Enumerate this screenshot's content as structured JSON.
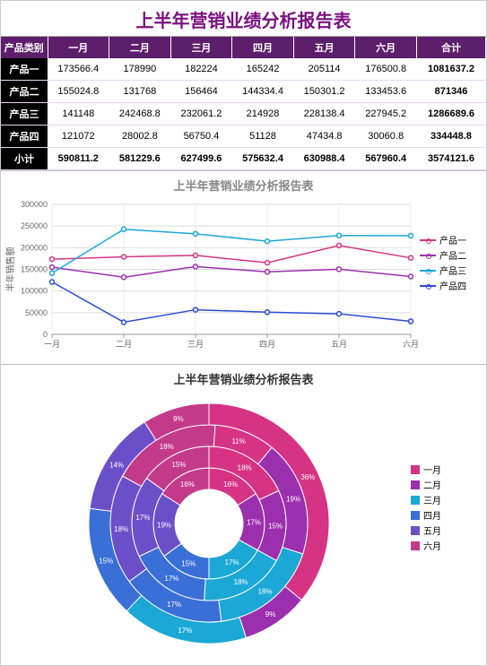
{
  "title": "上半年营销业绩分析报告表",
  "table": {
    "headers": [
      "产品类别",
      "一月",
      "二月",
      "三月",
      "四月",
      "五月",
      "六月",
      "合计"
    ],
    "rows": [
      {
        "name": "产品一",
        "vals": [
          "173566.4",
          "178990",
          "182224",
          "165242",
          "205114",
          "176500.8"
        ],
        "total": "1081637.2"
      },
      {
        "name": "产品二",
        "vals": [
          "155024.8",
          "131768",
          "156464",
          "144334.4",
          "150301.2",
          "133453.6"
        ],
        "total": "871346"
      },
      {
        "name": "产品三",
        "vals": [
          "141148",
          "242468.8",
          "232061.2",
          "214928",
          "228138.4",
          "227945.2"
        ],
        "total": "1286689.6"
      },
      {
        "name": "产品四",
        "vals": [
          "121072",
          "28002.8",
          "56750.4",
          "51128",
          "47434.8",
          "30060.8"
        ],
        "total": "334448.8"
      }
    ],
    "subtotal": {
      "name": "小计",
      "vals": [
        "590811.2",
        "581229.6",
        "627499.6",
        "575632.4",
        "630988.4",
        "567960.4"
      ],
      "total": "3574121.6"
    }
  },
  "colors": {
    "p1": "#d63384",
    "p2": "#9b2fae",
    "p3": "#1ba8d6",
    "p4": "#2a4bd1",
    "m1": "#d63384",
    "m2": "#9b2fae",
    "m3": "#1ba8d6",
    "m4": "#3a6fd8",
    "m5": "#6b4fc9",
    "m6": "#c43a8a"
  },
  "chart_data": [
    {
      "type": "line",
      "title": "上半年营销业绩分析报告表",
      "categories": [
        "一月",
        "二月",
        "三月",
        "四月",
        "五月",
        "六月"
      ],
      "ylabel": "半年销售额",
      "ylim": [
        0,
        300000
      ],
      "yticks": [
        0,
        50000,
        100000,
        150000,
        200000,
        250000,
        300000
      ],
      "series": [
        {
          "name": "产品一",
          "color": "#d63384",
          "values": [
            173566.4,
            178990,
            182224,
            165242,
            205114,
            176500.8
          ]
        },
        {
          "name": "产品二",
          "color": "#9b2fae",
          "values": [
            155024.8,
            131768,
            156464,
            144334.4,
            150301.2,
            133453.6
          ]
        },
        {
          "name": "产品三",
          "color": "#1ba8d6",
          "values": [
            141148,
            242468.8,
            232061.2,
            214928,
            228138.4,
            227945.2
          ]
        },
        {
          "name": "产品四",
          "color": "#2a4bd1",
          "values": [
            121072,
            28002.8,
            56750.4,
            51128,
            47434.8,
            30060.8
          ]
        }
      ]
    },
    {
      "type": "nested-donut",
      "title": "上半年营销业绩分析报告表",
      "categories": [
        "一月",
        "二月",
        "三月",
        "四月",
        "五月",
        "六月"
      ],
      "month_colors": [
        "#d63384",
        "#9b2fae",
        "#1ba8d6",
        "#3a6fd8",
        "#6b4fc9",
        "#c43a8a"
      ],
      "rings": [
        {
          "name": "产品一",
          "percents": [
            16,
            17,
            17,
            15,
            19,
            16
          ]
        },
        {
          "name": "产品二",
          "percents": [
            18,
            15,
            18,
            17,
            17,
            15
          ]
        },
        {
          "name": "产品三",
          "percents": [
            11,
            19,
            18,
            17,
            18,
            18
          ]
        },
        {
          "name": "产品四",
          "percents": [
            36,
            9,
            17,
            15,
            14,
            9
          ]
        }
      ]
    }
  ],
  "legend_labels": {
    "p1": "产品一",
    "p2": "产品二",
    "p3": "产品三",
    "p4": "产品四"
  },
  "month_labels": {
    "m1": "一月",
    "m2": "二月",
    "m3": "三月",
    "m4": "四月",
    "m5": "五月",
    "m6": "六月"
  }
}
